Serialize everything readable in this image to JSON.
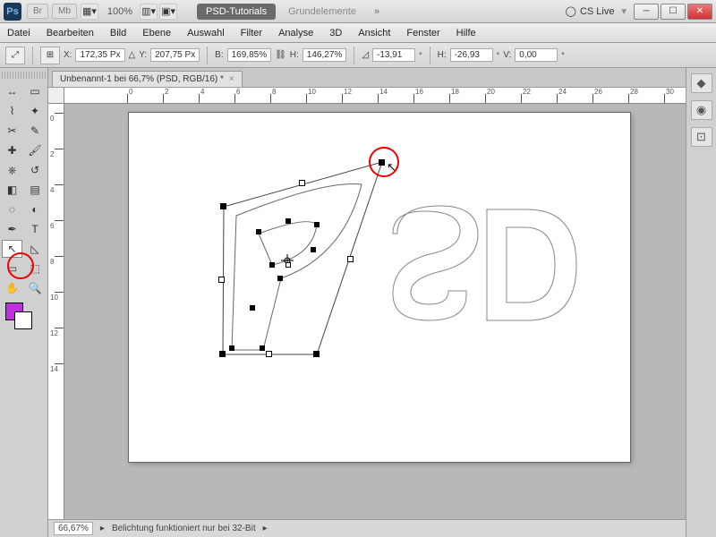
{
  "titlebar": {
    "br": "Br",
    "mb": "Mb",
    "pct": "100%",
    "workspace_active": "PSD-Tutorials",
    "workspace_inactive": "Grundelemente",
    "cslive": "CS Live"
  },
  "menu": [
    "Datei",
    "Bearbeiten",
    "Bild",
    "Ebene",
    "Auswahl",
    "Filter",
    "Analyse",
    "3D",
    "Ansicht",
    "Fenster",
    "Hilfe"
  ],
  "options": {
    "x_lbl": "X:",
    "x_val": "172,35 Px",
    "y_lbl": "Y:",
    "y_val": "207,75 Px",
    "w_lbl": "B:",
    "w_val": "169,85%",
    "h_lbl": "H:",
    "h_val": "146,27%",
    "a_val": "-13,91",
    "hskew_lbl": "H:",
    "hskew_val": "-26,93",
    "vskew_lbl": "V:",
    "vskew_val": "0,00"
  },
  "doc_tab": "Unbenannt-1 bei 66,7% (PSD, RGB/16) *",
  "ruler_h": [
    0,
    2,
    4,
    6,
    8,
    10,
    12,
    14,
    16,
    18,
    20,
    22,
    24,
    26,
    28,
    30
  ],
  "ruler_v": [
    0,
    2,
    4,
    6,
    8,
    10,
    12,
    14
  ],
  "status": {
    "zoom": "66,67%",
    "msg": "Belichtung funktioniert nur bei 32-Bit"
  },
  "tools": [
    {
      "n": "move",
      "g": "↔"
    },
    {
      "n": "marquee",
      "g": "▭"
    },
    {
      "n": "lasso",
      "g": "⌇"
    },
    {
      "n": "wand",
      "g": "✦"
    },
    {
      "n": "crop",
      "g": "✂"
    },
    {
      "n": "eyedrop",
      "g": "✎"
    },
    {
      "n": "heal",
      "g": "✚"
    },
    {
      "n": "brush",
      "g": "🖌"
    },
    {
      "n": "stamp",
      "g": "⎈"
    },
    {
      "n": "history",
      "g": "↺"
    },
    {
      "n": "eraser",
      "g": "◧"
    },
    {
      "n": "grad",
      "g": "▤"
    },
    {
      "n": "blur",
      "g": "◌"
    },
    {
      "n": "dodge",
      "g": "◐"
    },
    {
      "n": "pen",
      "g": "✒"
    },
    {
      "n": "type",
      "g": "T"
    },
    {
      "n": "path-sel",
      "g": "↖",
      "sel": true
    },
    {
      "n": "direct",
      "g": "◺"
    },
    {
      "n": "shape",
      "g": "▭"
    },
    {
      "n": "3d",
      "g": "⬚"
    },
    {
      "n": "hand",
      "g": "✋"
    },
    {
      "n": "zoom",
      "g": "🔍"
    }
  ]
}
